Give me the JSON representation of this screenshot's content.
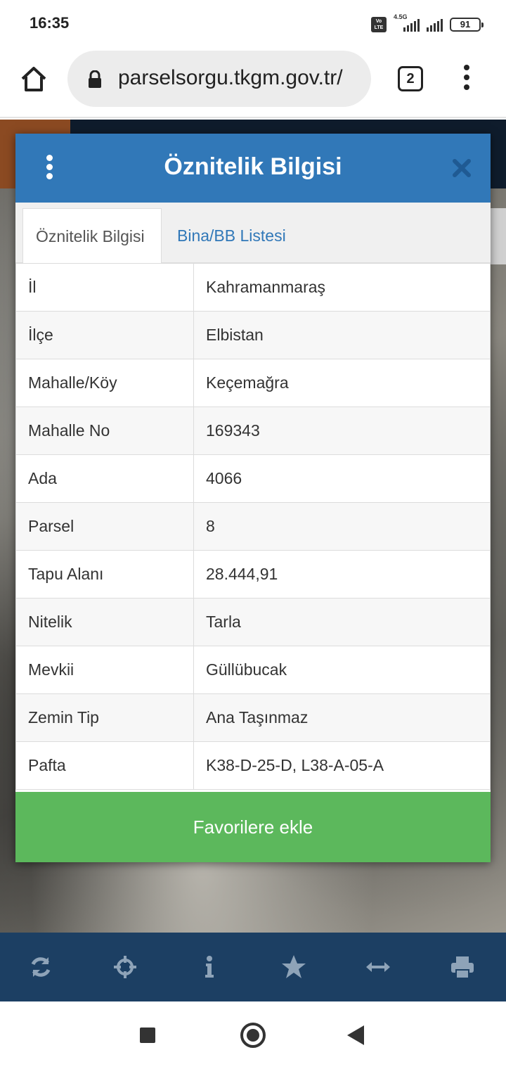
{
  "status_bar": {
    "time": "16:35",
    "volte": "Vo LTE",
    "network": "4.5G",
    "battery": "91"
  },
  "browser": {
    "url": "parselsorgu.tkgm.gov.tr/",
    "tab_count": "2"
  },
  "modal": {
    "title": "Öznitelik Bilgisi",
    "tabs": [
      {
        "label": "Öznitelik Bilgisi",
        "active": true
      },
      {
        "label": "Bina/BB Listesi",
        "active": false
      }
    ],
    "rows": [
      {
        "key": "İl",
        "value": "Kahramanmaraş"
      },
      {
        "key": "İlçe",
        "value": "Elbistan"
      },
      {
        "key": "Mahalle/Köy",
        "value": "Keçemağra"
      },
      {
        "key": "Mahalle No",
        "value": "169343"
      },
      {
        "key": "Ada",
        "value": "4066"
      },
      {
        "key": "Parsel",
        "value": "8"
      },
      {
        "key": "Tapu Alanı",
        "value": "28.444,91"
      },
      {
        "key": "Nitelik",
        "value": "Tarla"
      },
      {
        "key": "Mevkii",
        "value": "Güllübucak"
      },
      {
        "key": "Zemin Tip",
        "value": "Ana Taşınmaz"
      },
      {
        "key": "Pafta",
        "value": "K38-D-25-D, L38-A-05-A"
      }
    ],
    "favorite_button": "Favorilere ekle"
  },
  "toolbar": {
    "icons": [
      "refresh-icon",
      "crosshair-icon",
      "info-icon",
      "star-icon",
      "measure-icon",
      "print-icon"
    ]
  },
  "colors": {
    "header_blue": "#3178b8",
    "button_green": "#5cb85c",
    "toolbar_navy": "#1c3f63",
    "toolbar_icon": "#8ea3b8"
  }
}
